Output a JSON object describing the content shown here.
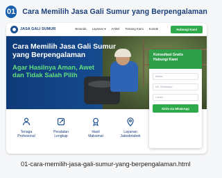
{
  "caption": {
    "number": "01",
    "title": "Cara Memilih Jasa Gali Sumur yang Berpengalaman"
  },
  "site": {
    "logo_text": "JASA GALI SUMUR",
    "menu": [
      "Beranda",
      "Layanan ▾",
      "Artikel",
      "Tentang Kami",
      "Kontak"
    ],
    "nav_cta": "Hubungi Kami"
  },
  "hero": {
    "title_line1": "Cara Memilih Jasa Gali Sumur",
    "title_line2": "yang Berpengalaman",
    "sub_line1": "Agar Hasilnya Aman, Awet",
    "sub_line2": "dan Tidak Salah Pilih"
  },
  "form": {
    "head_line1": "Konsultasi Gratis",
    "head_line2": "Hubungi Kami",
    "field_name": "Nama",
    "field_whatsapp": "No. WhatsApp",
    "field_location": "Lokasi",
    "button": "Kirim via WhatsApp"
  },
  "features": [
    {
      "line1": "Tenaga",
      "line2": "Profesional",
      "icon": "users-icon"
    },
    {
      "line1": "Peralatan",
      "line2": "Lengkap",
      "icon": "tools-icon"
    },
    {
      "line1": "Hasil",
      "line2": "Maksimal",
      "icon": "medal-icon"
    },
    {
      "line1": "Layanan",
      "line2": "Jabodetabek",
      "icon": "location-icon"
    }
  ],
  "filename": "01-cara-memilih-jasa-gali-sumur-yang-berpengalaman.html",
  "colors": {
    "brand_blue": "#1b3f7a",
    "accent_green": "#2ea94b",
    "hero_green_text": "#62e07d"
  }
}
